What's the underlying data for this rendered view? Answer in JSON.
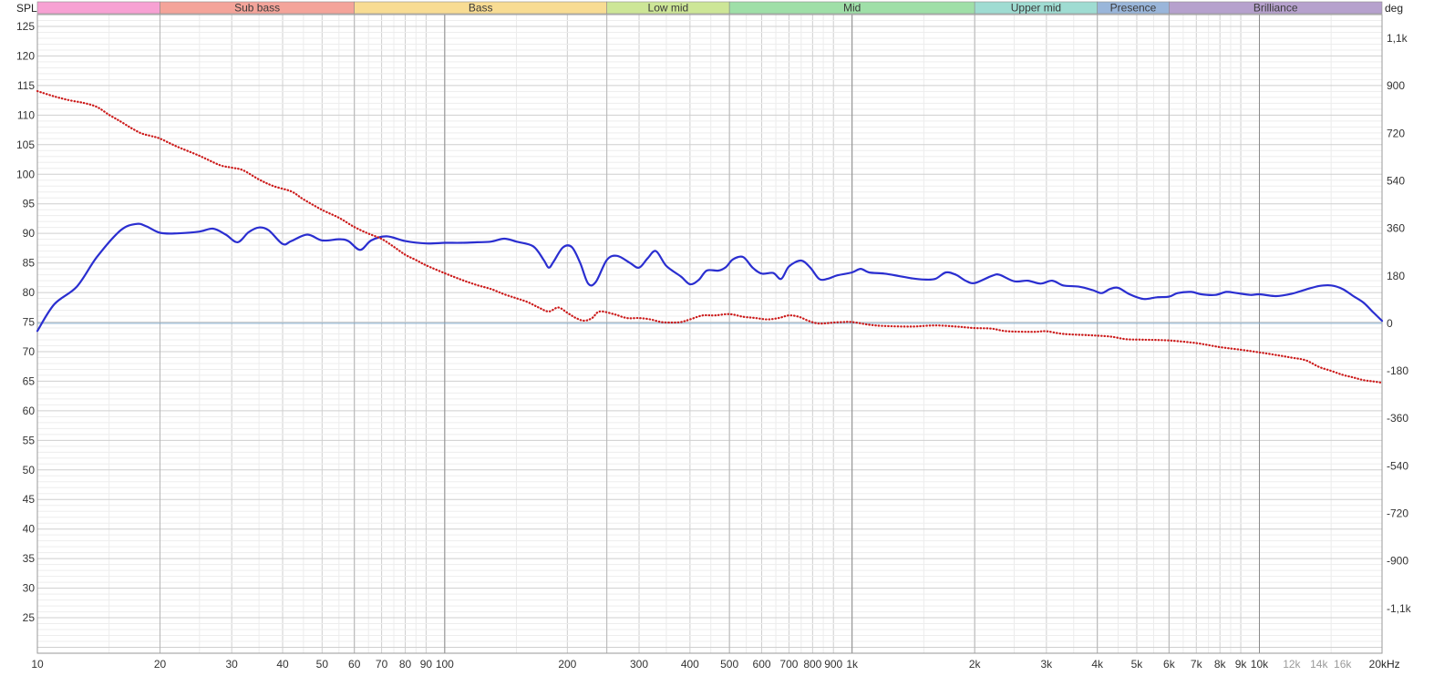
{
  "chart_data": {
    "type": "line",
    "x_scale": "log",
    "xlim": [
      10,
      20000
    ],
    "ylim": [
      19,
      127
    ],
    "y2lim": [
      -1250,
      1170
    ],
    "grid": true,
    "y_unit": "SPL",
    "y2_unit": "deg",
    "x_unit": "kHz",
    "y_ticks": [
      25,
      30,
      35,
      40,
      45,
      50,
      55,
      60,
      65,
      70,
      75,
      80,
      85,
      90,
      95,
      100,
      105,
      110,
      115,
      120,
      125
    ],
    "y2_ticks": [
      {
        "v": 1080,
        "label": "1,1k"
      },
      {
        "v": 900,
        "label": "900"
      },
      {
        "v": 720,
        "label": "720"
      },
      {
        "v": 540,
        "label": "540"
      },
      {
        "v": 360,
        "label": "360"
      },
      {
        "v": 180,
        "label": "180"
      },
      {
        "v": 0,
        "label": "0"
      },
      {
        "v": -180,
        "label": "-180"
      },
      {
        "v": -360,
        "label": "-360"
      },
      {
        "v": -540,
        "label": "-540"
      },
      {
        "v": -720,
        "label": "-720"
      },
      {
        "v": -900,
        "label": "-900"
      },
      {
        "v": -1080,
        "label": "-1,1k"
      }
    ],
    "x_ticks": [
      {
        "v": 10,
        "label": "10"
      },
      {
        "v": 20,
        "label": "20"
      },
      {
        "v": 30,
        "label": "30"
      },
      {
        "v": 40,
        "label": "40"
      },
      {
        "v": 50,
        "label": "50"
      },
      {
        "v": 60,
        "label": "60"
      },
      {
        "v": 70,
        "label": "70"
      },
      {
        "v": 80,
        "label": "80"
      },
      {
        "v": 90,
        "label": "90"
      },
      {
        "v": 100,
        "label": "100"
      },
      {
        "v": 200,
        "label": "200"
      },
      {
        "v": 300,
        "label": "300"
      },
      {
        "v": 400,
        "label": "400"
      },
      {
        "v": 500,
        "label": "500"
      },
      {
        "v": 600,
        "label": "600"
      },
      {
        "v": 700,
        "label": "700"
      },
      {
        "v": 800,
        "label": "800"
      },
      {
        "v": 900,
        "label": "900"
      },
      {
        "v": 1000,
        "label": "1k"
      },
      {
        "v": 2000,
        "label": "2k"
      },
      {
        "v": 3000,
        "label": "3k"
      },
      {
        "v": 4000,
        "label": "4k"
      },
      {
        "v": 5000,
        "label": "5k"
      },
      {
        "v": 6000,
        "label": "6k"
      },
      {
        "v": 7000,
        "label": "7k"
      },
      {
        "v": 8000,
        "label": "8k"
      },
      {
        "v": 9000,
        "label": "9k"
      },
      {
        "v": 10000,
        "label": "10k"
      },
      {
        "v": 12000,
        "label": "12k",
        "faded": true
      },
      {
        "v": 14000,
        "label": "14k",
        "faded": true
      },
      {
        "v": 16000,
        "label": "16k",
        "faded": true
      },
      {
        "v": 20000,
        "label": "20"
      }
    ],
    "bands": [
      {
        "name": "",
        "from": 10,
        "to": 20,
        "color": "#f7a1d3"
      },
      {
        "name": "Sub bass",
        "from": 20,
        "to": 60,
        "color": "#f4a49a"
      },
      {
        "name": "Bass",
        "from": 60,
        "to": 250,
        "color": "#f8dc93"
      },
      {
        "name": "Low mid",
        "from": 250,
        "to": 500,
        "color": "#cde697"
      },
      {
        "name": "Mid",
        "from": 500,
        "to": 2000,
        "color": "#9fdfa8"
      },
      {
        "name": "Upper mid",
        "from": 2000,
        "to": 4000,
        "color": "#9fdcd2"
      },
      {
        "name": "Presence",
        "from": 4000,
        "to": 6000,
        "color": "#9ab6da"
      },
      {
        "name": "Brilliance",
        "from": 6000,
        "to": 20000,
        "color": "#b6a1cd"
      }
    ],
    "series": [
      {
        "axis": "left",
        "color": "#2a2ed0",
        "style": "solid",
        "points": [
          [
            10,
            73.5
          ],
          [
            11,
            78
          ],
          [
            12.5,
            81
          ],
          [
            14,
            86
          ],
          [
            16,
            90.5
          ],
          [
            17.5,
            91.6
          ],
          [
            18.5,
            91.2
          ],
          [
            20,
            90.1
          ],
          [
            22,
            90
          ],
          [
            25,
            90.3
          ],
          [
            27,
            90.8
          ],
          [
            29,
            89.8
          ],
          [
            31,
            88.5
          ],
          [
            33,
            90.2
          ],
          [
            35,
            91
          ],
          [
            37,
            90.5
          ],
          [
            40,
            88.2
          ],
          [
            42,
            88.7
          ],
          [
            46,
            89.8
          ],
          [
            50,
            88.8
          ],
          [
            55,
            89
          ],
          [
            58,
            88.7
          ],
          [
            62,
            87.2
          ],
          [
            66,
            88.8
          ],
          [
            72,
            89.5
          ],
          [
            80,
            88.7
          ],
          [
            90,
            88.3
          ],
          [
            100,
            88.4
          ],
          [
            110,
            88.4
          ],
          [
            120,
            88.5
          ],
          [
            130,
            88.6
          ],
          [
            140,
            89.1
          ],
          [
            150,
            88.6
          ],
          [
            165,
            87.8
          ],
          [
            175,
            85.5
          ],
          [
            180,
            84.2
          ],
          [
            185,
            85.2
          ],
          [
            195,
            87.6
          ],
          [
            205,
            87.7
          ],
          [
            215,
            85
          ],
          [
            225,
            81.5
          ],
          [
            235,
            81.8
          ],
          [
            250,
            85.5
          ],
          [
            265,
            86.2
          ],
          [
            285,
            85
          ],
          [
            300,
            84.2
          ],
          [
            315,
            85.8
          ],
          [
            330,
            87
          ],
          [
            350,
            84.5
          ],
          [
            380,
            82.7
          ],
          [
            400,
            81.4
          ],
          [
            420,
            82.1
          ],
          [
            440,
            83.7
          ],
          [
            470,
            83.7
          ],
          [
            490,
            84.3
          ],
          [
            510,
            85.6
          ],
          [
            540,
            86
          ],
          [
            570,
            84.2
          ],
          [
            600,
            83.2
          ],
          [
            640,
            83.3
          ],
          [
            670,
            82.3
          ],
          [
            700,
            84.4
          ],
          [
            750,
            85.4
          ],
          [
            790,
            84.2
          ],
          [
            830,
            82.3
          ],
          [
            870,
            82.3
          ],
          [
            920,
            82.9
          ],
          [
            1000,
            83.4
          ],
          [
            1050,
            84
          ],
          [
            1100,
            83.4
          ],
          [
            1200,
            83.2
          ],
          [
            1300,
            82.8
          ],
          [
            1400,
            82.4
          ],
          [
            1500,
            82.2
          ],
          [
            1600,
            82.3
          ],
          [
            1700,
            83.4
          ],
          [
            1800,
            83
          ],
          [
            1900,
            82
          ],
          [
            2000,
            81.6
          ],
          [
            2200,
            82.8
          ],
          [
            2300,
            83
          ],
          [
            2500,
            81.9
          ],
          [
            2700,
            82
          ],
          [
            2900,
            81.5
          ],
          [
            3100,
            82
          ],
          [
            3300,
            81.2
          ],
          [
            3600,
            81
          ],
          [
            3900,
            80.4
          ],
          [
            4100,
            79.9
          ],
          [
            4300,
            80.6
          ],
          [
            4500,
            80.8
          ],
          [
            4800,
            79.7
          ],
          [
            5200,
            78.9
          ],
          [
            5600,
            79.2
          ],
          [
            6000,
            79.3
          ],
          [
            6300,
            79.9
          ],
          [
            6800,
            80.1
          ],
          [
            7200,
            79.7
          ],
          [
            7800,
            79.6
          ],
          [
            8300,
            80.1
          ],
          [
            8800,
            79.9
          ],
          [
            9500,
            79.6
          ],
          [
            10000,
            79.7
          ],
          [
            11000,
            79.4
          ],
          [
            12000,
            79.8
          ],
          [
            13000,
            80.5
          ],
          [
            14000,
            81.1
          ],
          [
            15000,
            81.2
          ],
          [
            16000,
            80.6
          ],
          [
            17000,
            79.4
          ],
          [
            18000,
            78.3
          ],
          [
            19000,
            76.7
          ],
          [
            20000,
            75.2
          ]
        ]
      },
      {
        "axis": "right",
        "color": "#cc1a1a",
        "style": "dotted",
        "points": [
          [
            10,
            880
          ],
          [
            11,
            860
          ],
          [
            12,
            845
          ],
          [
            13,
            835
          ],
          [
            14,
            820
          ],
          [
            15,
            790
          ],
          [
            16,
            765
          ],
          [
            17,
            740
          ],
          [
            18,
            720
          ],
          [
            19,
            710
          ],
          [
            20,
            700
          ],
          [
            22,
            670
          ],
          [
            25,
            635
          ],
          [
            28,
            600
          ],
          [
            30,
            590
          ],
          [
            32,
            580
          ],
          [
            35,
            545
          ],
          [
            38,
            520
          ],
          [
            42,
            500
          ],
          [
            45,
            470
          ],
          [
            50,
            430
          ],
          [
            55,
            400
          ],
          [
            60,
            365
          ],
          [
            65,
            340
          ],
          [
            70,
            320
          ],
          [
            75,
            290
          ],
          [
            80,
            260
          ],
          [
            85,
            240
          ],
          [
            90,
            220
          ],
          [
            100,
            190
          ],
          [
            110,
            165
          ],
          [
            120,
            145
          ],
          [
            130,
            130
          ],
          [
            140,
            110
          ],
          [
            150,
            95
          ],
          [
            160,
            80
          ],
          [
            170,
            60
          ],
          [
            180,
            45
          ],
          [
            190,
            60
          ],
          [
            200,
            40
          ],
          [
            210,
            20
          ],
          [
            220,
            10
          ],
          [
            230,
            20
          ],
          [
            240,
            45
          ],
          [
            260,
            35
          ],
          [
            280,
            20
          ],
          [
            300,
            20
          ],
          [
            320,
            15
          ],
          [
            340,
            5
          ],
          [
            360,
            3
          ],
          [
            380,
            5
          ],
          [
            400,
            15
          ],
          [
            430,
            30
          ],
          [
            460,
            30
          ],
          [
            500,
            35
          ],
          [
            540,
            25
          ],
          [
            580,
            20
          ],
          [
            620,
            15
          ],
          [
            660,
            20
          ],
          [
            700,
            30
          ],
          [
            740,
            25
          ],
          [
            780,
            10
          ],
          [
            820,
            0
          ],
          [
            860,
            0
          ],
          [
            900,
            3
          ],
          [
            950,
            5
          ],
          [
            1000,
            5
          ],
          [
            1100,
            -5
          ],
          [
            1200,
            -10
          ],
          [
            1400,
            -12
          ],
          [
            1600,
            -8
          ],
          [
            1800,
            -12
          ],
          [
            1900,
            -15
          ],
          [
            2000,
            -18
          ],
          [
            2200,
            -20
          ],
          [
            2400,
            -30
          ],
          [
            2800,
            -32
          ],
          [
            3000,
            -30
          ],
          [
            3300,
            -40
          ],
          [
            3800,
            -45
          ],
          [
            4300,
            -50
          ],
          [
            4700,
            -60
          ],
          [
            5200,
            -62
          ],
          [
            6000,
            -65
          ],
          [
            7000,
            -75
          ],
          [
            8000,
            -90
          ],
          [
            9000,
            -100
          ],
          [
            10000,
            -110
          ],
          [
            11000,
            -120
          ],
          [
            12000,
            -130
          ],
          [
            13000,
            -140
          ],
          [
            14000,
            -165
          ],
          [
            15000,
            -180
          ],
          [
            16000,
            -195
          ],
          [
            17000,
            -205
          ],
          [
            18000,
            -215
          ],
          [
            19000,
            -220
          ],
          [
            20000,
            -225
          ]
        ]
      }
    ]
  }
}
